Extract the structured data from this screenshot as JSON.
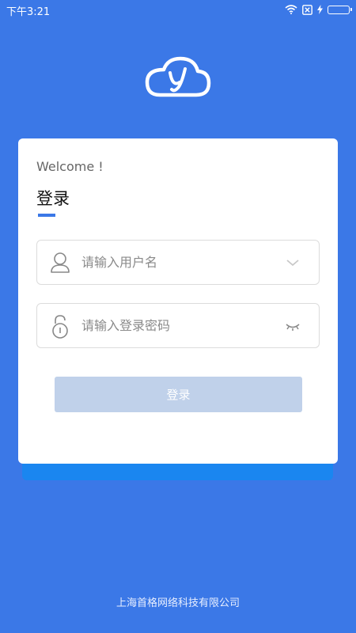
{
  "status_bar": {
    "time": "下午3:21"
  },
  "card": {
    "welcome": "Welcome !",
    "title": "登录",
    "username": {
      "placeholder": "请输入用户名",
      "value": ""
    },
    "password": {
      "placeholder": "请输入登录密码",
      "value": ""
    },
    "login_button": "登录"
  },
  "footer": {
    "company": "上海首格网络科技有限公司"
  },
  "colors": {
    "background": "#3b78e7",
    "button_disabled": "#c0d1ea",
    "accent": "#3b78e7"
  },
  "icons": [
    "wifi-icon",
    "sim-icon",
    "charge-icon",
    "battery-icon",
    "cloud-logo-icon",
    "user-icon",
    "lock-icon",
    "chevron-down-icon",
    "eye-closed-icon"
  ]
}
